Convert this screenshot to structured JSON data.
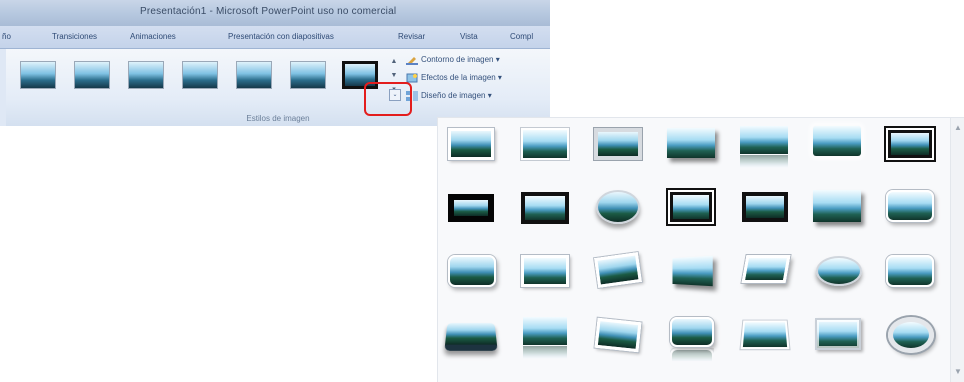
{
  "window": {
    "title": "Presentación1 - Microsoft PowerPoint uso no comercial"
  },
  "ribbon": {
    "tabs": [
      "ño",
      "Transiciones",
      "Animaciones",
      "Presentación con diapositivas",
      "Revisar",
      "Vista",
      "Compl"
    ],
    "commands": [
      {
        "label": "Contorno de imagen ▾",
        "icon": "pencil-outline-icon"
      },
      {
        "label": "Efectos de la imagen ▾",
        "icon": "picture-effects-icon"
      },
      {
        "label": "Diseño de imagen ▾",
        "icon": "picture-layout-icon"
      }
    ],
    "group_label": "Estilos de imagen",
    "gallery_scroll": [
      "▲",
      "▼",
      "▾"
    ],
    "launcher_glyph": "⌄"
  },
  "expanded_gallery": {
    "scroll_up": "▲",
    "scroll_down": "▼"
  },
  "colors": {
    "highlight": "#e31d1d",
    "ribbon_bg": "#dfe8f5"
  }
}
